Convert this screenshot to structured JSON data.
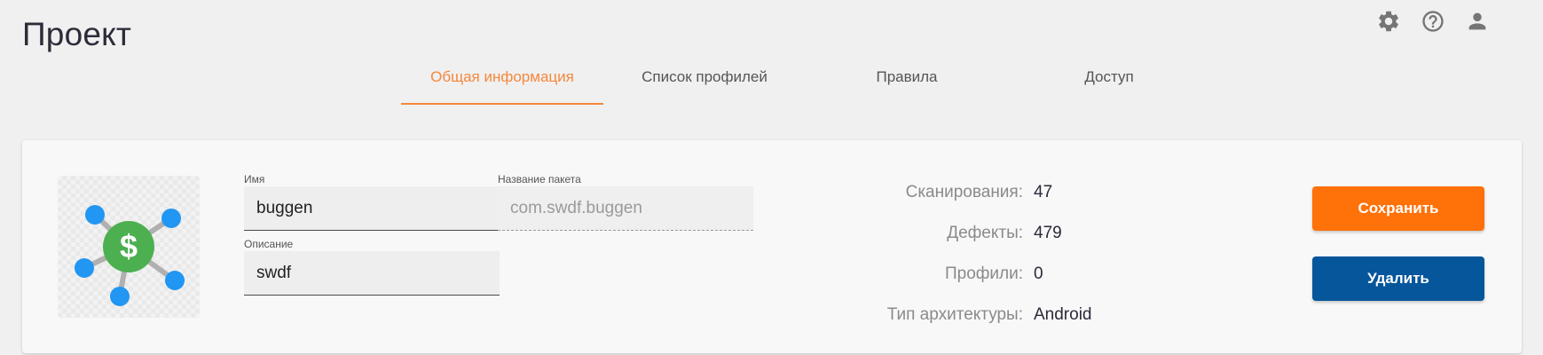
{
  "header": {
    "title": "Проект",
    "icons": [
      "gear-icon",
      "help-icon",
      "account-icon"
    ]
  },
  "tabs": [
    {
      "label": "Общая информация",
      "active": true
    },
    {
      "label": "Список профилей",
      "active": false
    },
    {
      "label": "Правила",
      "active": false
    },
    {
      "label": "Доступ",
      "active": false
    }
  ],
  "form": {
    "name": {
      "label": "Имя",
      "value": "buggen"
    },
    "package": {
      "label": "Название пакета",
      "value": "com.swdf.buggen"
    },
    "description": {
      "label": "Описание",
      "value": "swdf"
    }
  },
  "stats": [
    {
      "label": "Сканирования:",
      "value": "47"
    },
    {
      "label": "Дефекты:",
      "value": "479"
    },
    {
      "label": "Профили:",
      "value": "0"
    },
    {
      "label": "Тип архитектуры:",
      "value": "Android"
    }
  ],
  "actions": {
    "save_label": "Сохранить",
    "delete_label": "Удалить"
  },
  "colors": {
    "accent": "#f5883d",
    "save_button": "#ff7109",
    "delete_button": "#05569a",
    "logo_center": "#4caf50",
    "logo_nodes": "#2196f3"
  }
}
